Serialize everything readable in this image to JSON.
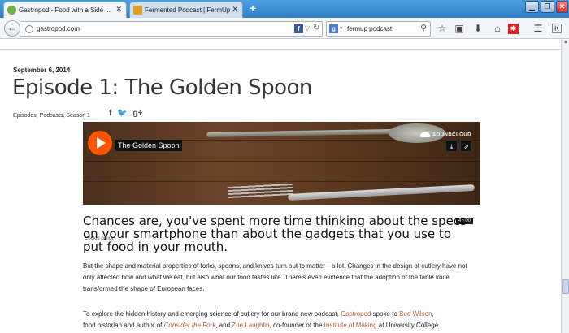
{
  "browser": {
    "tabs": [
      {
        "label": "Gastropod - Food with a Side ...",
        "active": true
      },
      {
        "label": "Fermented Podcast | FermUp",
        "active": false
      }
    ],
    "url": "gastropod.com",
    "search_engine": "Google",
    "search_query": "fermup podcast"
  },
  "article": {
    "date": "September 6, 2014",
    "title": "Episode 1: The Golden Spoon",
    "categories": [
      "Episodes",
      "Podcasts",
      "Season 1"
    ],
    "player": {
      "track": "The Golden Spoon",
      "brand": "SOUNDCLOUD",
      "duration": "45:00",
      "cookie": "Cookie policy",
      "accent": "#ff5500"
    },
    "headline": "Chances are, you've spent more time thinking about the specs on your smartphone than about the gadgets that you use to put food in your mouth.",
    "para1": "But the shape and material properties of forks, spoons, and knives turn out to matter—a lot. Changes in the design of cutlery have not only affected how and what we eat, but also what our food tastes like. There's even evidence that the adoption of the table knife transformed the shape of European faces.",
    "para2": {
      "t1": "To explore the hidden history and emerging science of cutlery for our brand new podcast, ",
      "l1": "Gastropod",
      "t2": " spoke to ",
      "l2": "Bee Wilson",
      "t3": ",",
      "t4": "food historian and author of ",
      "l3": "Consider the Fork",
      "t5": ", and ",
      "l4": "Zoe Laughlin",
      "t6": ", co-founder of the ",
      "l5": "Institute of Making",
      "t7": " at University College"
    },
    "link_color": "#b15b3a"
  }
}
